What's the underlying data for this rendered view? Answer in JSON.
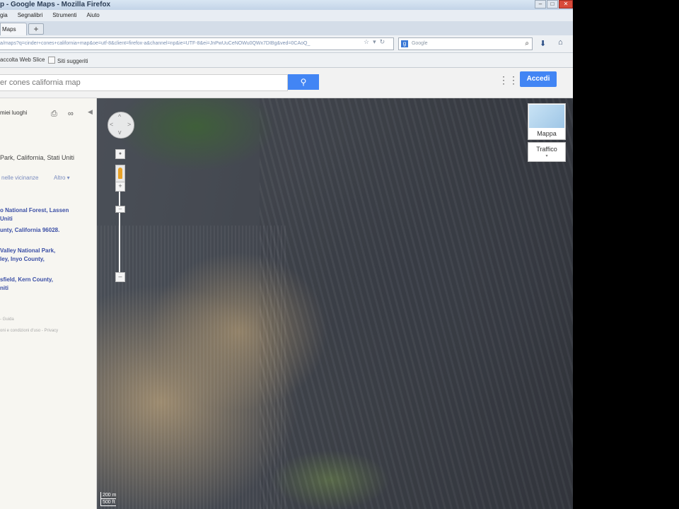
{
  "window": {
    "title": "p - Google Maps - Mozilla Firefox",
    "min": "–",
    "max": "□",
    "close": "✕"
  },
  "menubar": [
    "gia",
    "Segnalibri",
    "Strumenti",
    "Aiuto"
  ],
  "tabs": {
    "active_label": "Maps",
    "new_tab": "+"
  },
  "navbar": {
    "url": "a/maps?q=cinder+cones+california+map&oe=utf-8&client=firefox-a&channel=np&ie=UTF-8&ei=JnPwUuCeNOWu0QWx7DIBg&ved=0CAoQ_",
    "search_placeholder": "Google"
  },
  "bookmarks": {
    "item1": "accolta Web Slice",
    "item2": "Siti suggeriti"
  },
  "google": {
    "search_value": "er cones california map",
    "signin_label": "Accedi"
  },
  "left_panel": {
    "header": "miei luoghi",
    "address": "Park, California, Stati Uniti",
    "nearby": "nelle vicinanze",
    "more": "Altro ▾",
    "results": [
      {
        "line1": "o National Forest, Lassen",
        "line2": "Uniti"
      },
      {
        "line1": "unty, California 96028.",
        "line2": ""
      },
      {
        "line1": "Valley National Park,",
        "line2": "ley, Inyo County,"
      },
      {
        "line1": "sfield, Kern County,",
        "line2": "niti"
      }
    ],
    "footer1": "- Guida",
    "footer2": "oni e condizioni d'uso - Privacy"
  },
  "map": {
    "map_type_label": "Mappa",
    "traffic_label": "Traffico",
    "scale_metric": "200 m",
    "scale_imperial": "500 ft"
  }
}
